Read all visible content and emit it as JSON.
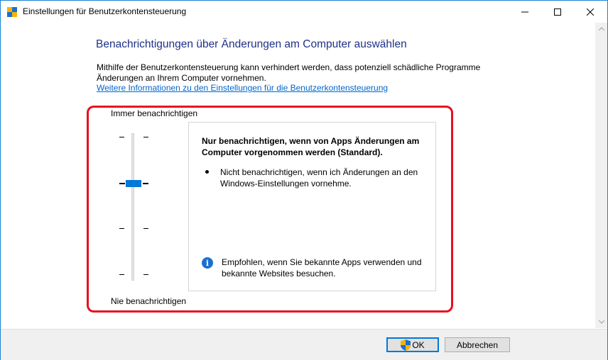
{
  "window": {
    "title": "Einstellungen für Benutzerkontensteuerung"
  },
  "main": {
    "heading": "Benachrichtigungen über Änderungen am Computer auswählen",
    "description": "Mithilfe der Benutzerkontensteuerung kann verhindert werden, dass potenziell schädliche Programme Änderungen an Ihrem Computer vornehmen.",
    "more_info_link": "Weitere Informationen zu den Einstellungen für die Benutzerkontensteuerung"
  },
  "slider": {
    "top_label": "Immer benachrichtigen",
    "bottom_label": "Nie benachrichtigen",
    "levels": 4,
    "selected_level": 3
  },
  "info": {
    "title": "Nur benachrichtigen, wenn von Apps Änderungen am Computer vorgenommen werden (Standard).",
    "bullet": "Nicht benachrichtigen, wenn ich Änderungen an den Windows-Einstellungen vornehme.",
    "recommendation": "Empfohlen, wenn Sie bekannte Apps verwenden und bekannte Websites besuchen."
  },
  "footer": {
    "ok_label": "OK",
    "cancel_label": "Abbrechen"
  },
  "colors": {
    "heading": "#1e3287",
    "link": "#0066cc",
    "accent": "#0078d7",
    "highlight": "#e8101e"
  },
  "icons": {
    "app": "uac-flag-icon",
    "info": "info-icon",
    "shield": "uac-shield-icon"
  }
}
